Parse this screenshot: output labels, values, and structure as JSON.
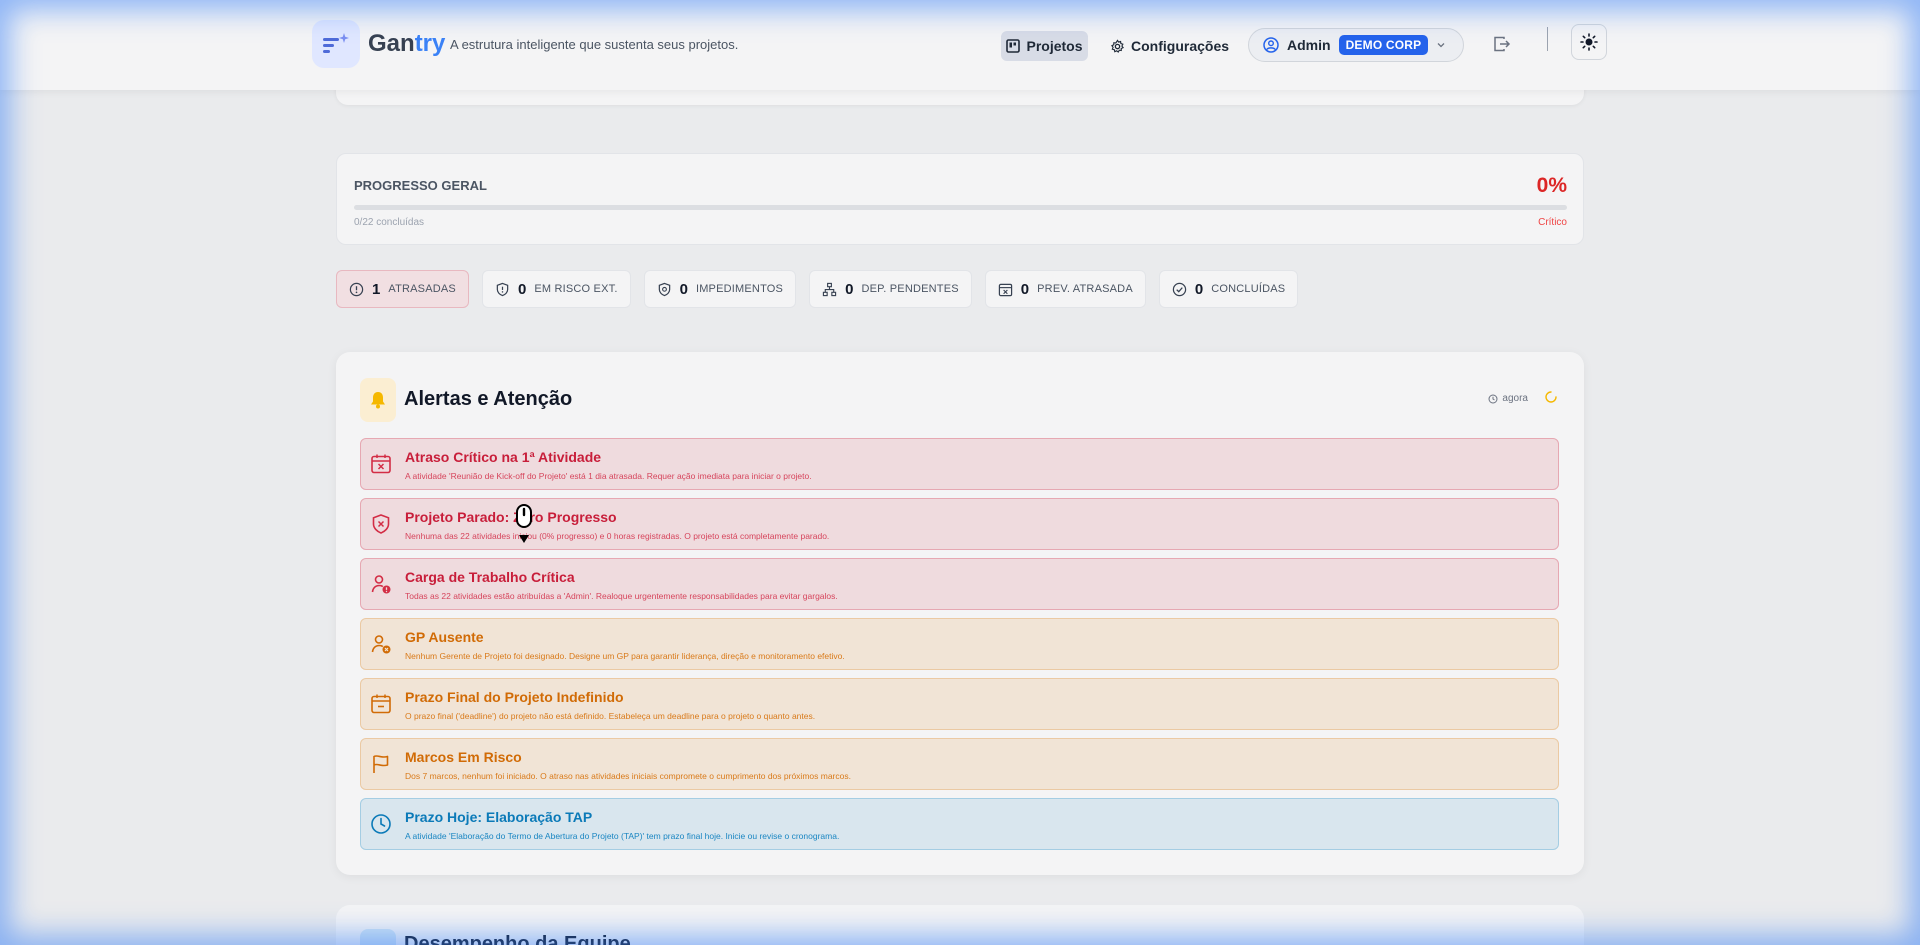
{
  "header": {
    "brand_prefix": "Gan",
    "brand_suffix": "try",
    "tagline": "A estrutura inteligente que sustenta seus projetos.",
    "nav": {
      "projetos": "Projetos",
      "configuracoes": "Configurações"
    },
    "user": {
      "name": "Admin",
      "org": "DEMO CORP"
    }
  },
  "progress": {
    "label": "PROGRESSO GERAL",
    "percent_text": "0%",
    "percent_value": 0,
    "count": "0/22 concluídas",
    "status": "Crítico"
  },
  "stats": [
    {
      "value": "1",
      "label": "ATRASADAS"
    },
    {
      "value": "0",
      "label": "EM RISCO EXT."
    },
    {
      "value": "0",
      "label": "IMPEDIMENTOS"
    },
    {
      "value": "0",
      "label": "DEP. PENDENTES"
    },
    {
      "value": "0",
      "label": "PREV. ATRASADA"
    },
    {
      "value": "0",
      "label": "CONCLUÍDAS"
    }
  ],
  "alerts_section": {
    "title": "Alertas e Atenção",
    "updated": "agora",
    "items": [
      {
        "title": "Atraso Crítico na 1ª Atividade",
        "desc": "A atividade 'Reunião de Kick-off do Projeto' está 1 dia atrasada. Requer ação imediata para iniciar o projeto.",
        "severity": "red",
        "icon": "calendar-x-icon"
      },
      {
        "title": "Projeto Parado: Zero Progresso",
        "desc": "Nenhuma das 22 atividades iniciou (0% progresso) e 0 horas registradas. O projeto está completamente parado.",
        "severity": "red",
        "icon": "shield-x-icon"
      },
      {
        "title": "Carga de Trabalho Crítica",
        "desc": "Todas as 22 atividades estão atribuídas a 'Admin'. Realoque urgentemente responsabilidades para evitar gargalos.",
        "severity": "red",
        "icon": "user-alert-icon"
      },
      {
        "title": "GP Ausente",
        "desc": "Nenhum Gerente de Projeto foi designado. Designe um GP para garantir liderança, direção e monitoramento efetivo.",
        "severity": "orange",
        "icon": "user-x-icon"
      },
      {
        "title": "Prazo Final do Projeto Indefinido",
        "desc": "O prazo final ('deadline') do projeto não está definido. Estabeleça um deadline para o projeto o quanto antes.",
        "severity": "orange",
        "icon": "calendar-minus-icon"
      },
      {
        "title": "Marcos Em Risco",
        "desc": "Dos 7 marcos, nenhum foi iniciado. O atraso nas atividades iniciais compromete o cumprimento dos próximos marcos.",
        "severity": "orange",
        "icon": "flag-icon"
      },
      {
        "title": "Prazo Hoje: Elaboração TAP",
        "desc": "A atividade 'Elaboração do Termo de Abertura do Projeto (TAP)' tem prazo final hoje. Inicie ou revise o cronograma.",
        "severity": "blue",
        "icon": "clock-icon"
      }
    ]
  },
  "next_section": {
    "title": "Desempenho da Equipe"
  }
}
